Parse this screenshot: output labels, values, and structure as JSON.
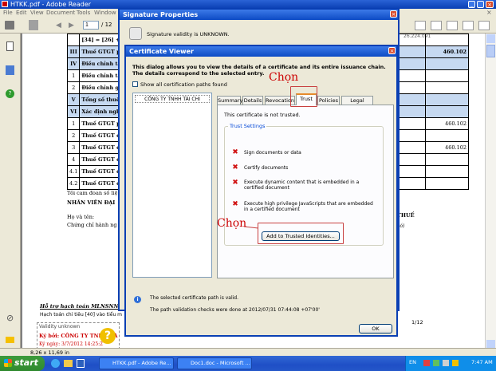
{
  "adobe": {
    "title": "HTKK.pdf - Adobe Reader",
    "menu": [
      "File",
      "Edit",
      "View",
      "Document",
      "Tools",
      "Window"
    ],
    "page_input": "1",
    "page_total": "/ 12",
    "status_size": "8,26 x 11,69 in",
    "page_of": "1/12",
    "doc": {
      "rows": [
        {
          "c1": "",
          "c2": "[34] = [26] +",
          "c3": "",
          "val": "",
          "blue": false
        },
        {
          "c1": "III",
          "c2": "Thuế GTGT p",
          "c3": "",
          "val": "460.102",
          "blue": true
        },
        {
          "c1": "IV",
          "c2": "Điều chỉnh tă",
          "c3": "",
          "val": "",
          "blue": true
        },
        {
          "c1": "1",
          "c2": "Điều chỉnh tă",
          "c3": "",
          "val": "",
          "blue": false
        },
        {
          "c1": "2",
          "c2": "Điều chỉnh giả",
          "c3": "",
          "val": "",
          "blue": false
        },
        {
          "c1": "V",
          "c2": "Tổng số thuế G",
          "c3": "",
          "val": "",
          "blue": true
        },
        {
          "c1": "VI",
          "c2": "Xác định nghĩ",
          "c3": "",
          "val": "",
          "blue": true
        },
        {
          "c1": "1",
          "c2": "Thuế GTGT p",
          "c3": "",
          "val": "460.102",
          "blue": false
        },
        {
          "c1": "2",
          "c2": "Thuế GTGT c",
          "c3": "",
          "val": "",
          "blue": false
        },
        {
          "c1": "3",
          "c2": "Thuế GTGT c",
          "c3": "",
          "val": "460.102",
          "blue": false
        },
        {
          "c1": "4",
          "c2": "Thuế GTGT c",
          "c3": "",
          "val": "",
          "blue": false
        },
        {
          "c1": "4.1",
          "c2": "Thuế GTGT đ",
          "c3": "",
          "val": "",
          "blue": false
        },
        {
          "c1": "4.2",
          "c2": "Thuế GTGT c",
          "c3": "",
          "val": "",
          "blue": false
        }
      ],
      "top_value": "26.224.091",
      "para1": "Tôi cam đoan số liệ",
      "para2": "NHÂN VIÊN ĐẠI",
      "para3": "Họ và tên:",
      "para4": "Chứng chỉ hành ng",
      "right_thue": "THUẾ",
      "right_co": "có)",
      "support_title": "Hỗ trợ hạch toán MLNSNN:",
      "support_text": "Hạch toán chỉ tiêu [40] vào tiểu m",
      "sig_status": "Validity unknown",
      "sig_by": "Ký bởi:  CÔNG TY TNHH TÀ",
      "sig_date": "Ký ngày:  3/7/2012 14:25:2"
    }
  },
  "sig_props": {
    "title": "Signature Properties",
    "validity": "Signature validity is UNKNOWN."
  },
  "cert_viewer": {
    "title": "Certificate Viewer",
    "description": "This dialog allows you to view the details of a certificate and its entire issuance chain. The details correspond to the selected entry.",
    "show_all_label": "Show all certification paths found",
    "chain_entry": "CÔNG TY TNHH TÀI CHI",
    "tabs": [
      "Summary",
      "Details",
      "Revocation",
      "Trust",
      "Policies",
      "Legal Notice"
    ],
    "active_tab": "Trust",
    "not_trusted": "This certificate is not trusted.",
    "trust_settings_label": "Trust Settings",
    "trust_items": [
      "Sign documents or data",
      "Certify documents",
      "Execute dynamic content that is embedded in a certified document",
      "Execute high privilege JavaScripts that are embedded in a certified document"
    ],
    "add_button": "Add to Trusted Identities...",
    "path_valid": "The selected certificate path is valid.",
    "validation_done": "The path validation checks were done at 2012/07/31 07:44:08 +07'00'",
    "ok_button": "OK"
  },
  "annotations": {
    "chon1": "Chọn",
    "chon2": "Chọn"
  },
  "taskbar": {
    "start": "start",
    "tasks": [
      "HTKK.pdf - Adobe Re...",
      "Doc1.doc - Microsoft ..."
    ],
    "clock": "7:47 AM",
    "lang": "EN"
  }
}
